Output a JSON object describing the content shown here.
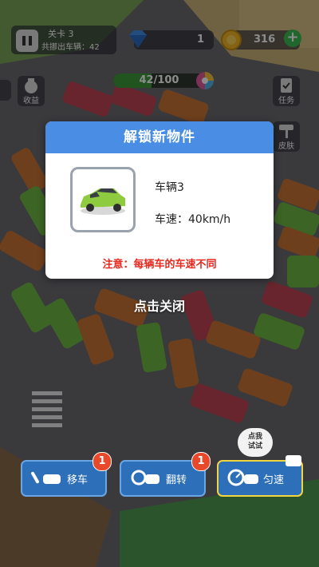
{
  "hud": {
    "level_title": "关卡 3",
    "cars_out_label": "共挪出车辆：",
    "cars_out_value": "42",
    "gems": "1",
    "coins": "316",
    "progress_text": "42/100",
    "progress_fraction": 0.42
  },
  "side_buttons": {
    "earnings": "收益",
    "tasks": "任务",
    "skins": "皮肤"
  },
  "modal": {
    "title": "解锁新物件",
    "vehicle_name": "车辆3",
    "speed_label": "车速：",
    "speed_value": "40km/h",
    "note": "注意：每辆车的车速不同"
  },
  "close_hint": "点击关闭",
  "actions": {
    "move_label": "移车",
    "move_badge": "1",
    "flip_label": "翻转",
    "flip_badge": "1",
    "speed_label": "匀速",
    "trial_bubble": "点我\n试试"
  },
  "colors": {
    "header_blue": "#4a8de4",
    "note_red": "#e8281e",
    "button_blue": "#2d6fb8",
    "badge_red": "#e8492a"
  }
}
